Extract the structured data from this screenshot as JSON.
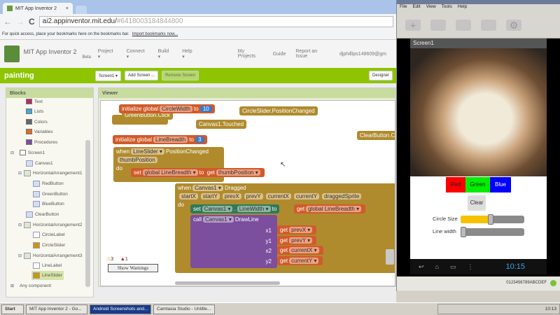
{
  "browser": {
    "tab_title": "MIT App Inventor 2",
    "tab_close": "×",
    "url_host": "ai2.appinventor.mit.edu/",
    "url_hash": "#6418003184844800",
    "back": "←",
    "forward": "→",
    "reload": "C",
    "bookmarks_hint": "For quick access, place your bookmarks here on the bookmarks bar.",
    "import_link": "Import bookmarks now..."
  },
  "header": {
    "title": "MIT App Inventor 2",
    "subtitle": "Beta",
    "menus": [
      "Project ▾",
      "Connect ▾",
      "Build ▾",
      "Help ▾"
    ],
    "links": [
      "My Projects",
      "Guide",
      "Report an Issue",
      "djphillips148609@gm"
    ]
  },
  "toolbar": {
    "project": "painting",
    "screen_select": "Screen1 ▾",
    "add_screen": "Add Screen ...",
    "remove_screen": "Remove Screen",
    "designer": "Designer"
  },
  "blocks_panel": {
    "title": "Blocks",
    "builtins": [
      {
        "label": "Text",
        "color": "#b32d5e"
      },
      {
        "label": "Lists",
        "color": "#49a6d4"
      },
      {
        "label": "Colors",
        "color": "#666666"
      },
      {
        "label": "Variables",
        "color": "#e06a26"
      },
      {
        "label": "Procedures",
        "color": "#7b4f9e"
      }
    ],
    "tree": [
      "Screen1",
      "Canvas1",
      "HorizontalArrangement1",
      "RedButton",
      "GreenButton",
      "BlueButton",
      "ClearButton",
      "HorizontalArrangement2",
      "CircleLabel",
      "CircleSlider",
      "HorizontalArrangement3",
      "LineLabel",
      "LineSlider"
    ],
    "any_component": "Any component"
  },
  "viewer": {
    "title": "Viewer",
    "blocks": {
      "init1": "initialize global",
      "var1": "CircleWidth",
      "to": "to",
      "val1": "10",
      "green_click": "GreenButton.Click",
      "circle_changed": "CircleSlider.PositionChanged",
      "canvas_touched": "Canvas1.Touched",
      "clear_click": "ClearButton.Click",
      "var2": "LineBreadth",
      "val2": "3",
      "when": "when",
      "line_slider": "LineSlider ▾",
      "position_changed": "PositionChanged",
      "thumb_param": "thumbPosition",
      "do": "do",
      "set": "set",
      "global_line": "global LineBreadth ▾",
      "get": "get",
      "thumb_get": "thumbPosition ▾",
      "canvas": "Canvas1 ▾",
      "dragged": "Dragged",
      "params": [
        "startX",
        "startY",
        "prevX",
        "prevY",
        "currentX",
        "currentY",
        "draggedSprite"
      ],
      "linewidth": "LineWidth ▾",
      "call": "call",
      "drawline": "DrawLine",
      "args": [
        "x1",
        "y1",
        "x2",
        "y2"
      ],
      "arg_vals": [
        "prevX ▾",
        "prevY ▾",
        "currentX ▾",
        "currentY ▾"
      ]
    },
    "warnings_count": "3",
    "errors_count": "1",
    "show_warnings": "Show Warnings"
  },
  "capture_window": {
    "menu": [
      "File",
      "Edit",
      "View",
      "Tools",
      "Help"
    ],
    "screen_title": "Screen1",
    "buttons": [
      {
        "label": "Red",
        "color": "#ff0000"
      },
      {
        "label": "Green",
        "color": "#00ee00"
      },
      {
        "label": "Blue",
        "color": "#0000ff"
      }
    ],
    "clear": "Clear",
    "circle_label": "Circle Size",
    "circle_value": 0.47,
    "line_label": "Line width",
    "line_value": 0.0,
    "time": "10:15",
    "device_id": "0123456789ABCDEF"
  },
  "taskbar": {
    "start": "Start",
    "items": [
      "MIT App Inventor 2 - Go...",
      "Android Screenshots and...",
      "Camtasia Studio - Untitle..."
    ],
    "clock": "10:13"
  }
}
